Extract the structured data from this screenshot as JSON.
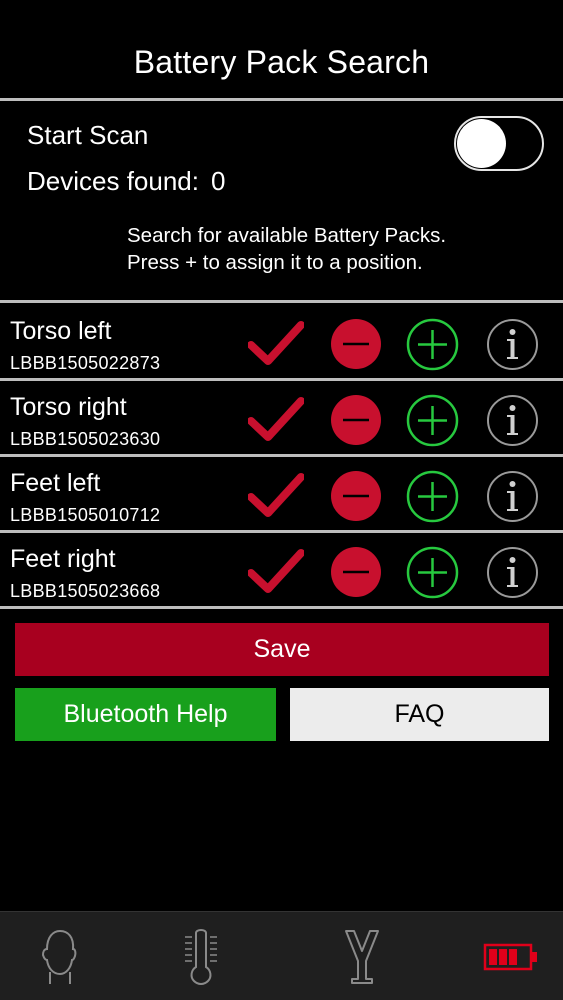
{
  "header": {
    "title": "Battery Pack Search"
  },
  "scan": {
    "start_label": "Start Scan",
    "toggle_on": false,
    "devices_label": "Devices found:",
    "devices_count": "0",
    "hint_line1": "Search for available Battery Packs.",
    "hint_line2": "Press + to assign it to a position."
  },
  "positions": [
    {
      "name": "Torso left",
      "serial": "LBBB1505022873"
    },
    {
      "name": "Torso right",
      "serial": "LBBB1505023630"
    },
    {
      "name": "Feet left",
      "serial": "LBBB1505010712"
    },
    {
      "name": "Feet right",
      "serial": "LBBB1505023668"
    }
  ],
  "buttons": {
    "save": "Save",
    "bluetooth_help": "Bluetooth Help",
    "faq": "FAQ"
  },
  "tabbar": {
    "items": [
      {
        "icon": "head-icon",
        "active": false
      },
      {
        "icon": "thermometer-icon",
        "active": false
      },
      {
        "icon": "vest-icon",
        "active": false
      },
      {
        "icon": "battery-icon",
        "active": true
      }
    ]
  },
  "colors": {
    "accent_red": "#c8102e",
    "save_red": "#a8001f",
    "green": "#18a01c",
    "plus_green": "#27c93f",
    "battery_red": "#e0001a"
  }
}
